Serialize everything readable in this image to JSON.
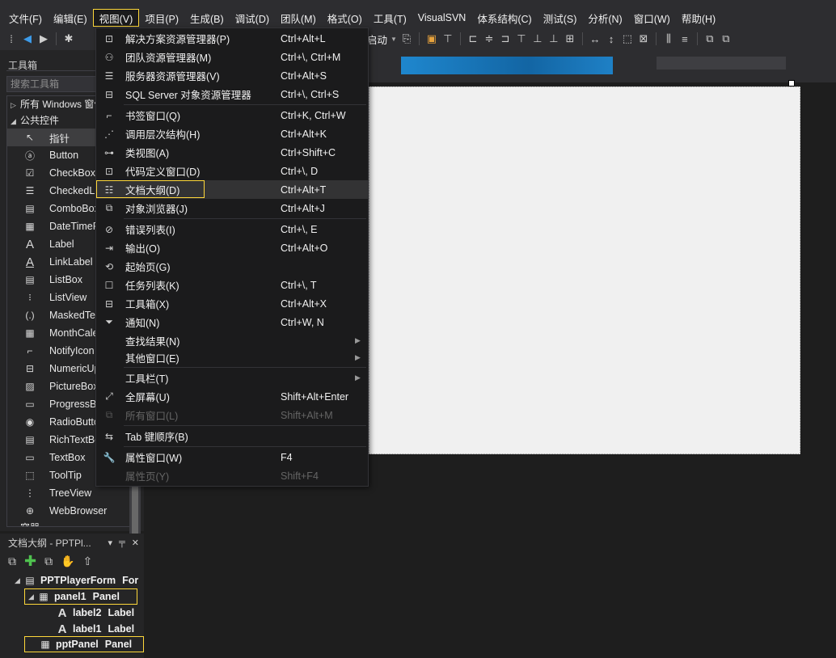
{
  "menubar": {
    "items": [
      "文件(F)",
      "编辑(E)",
      "视图(V)",
      "项目(P)",
      "生成(B)",
      "调试(D)",
      "团队(M)",
      "格式(O)",
      "工具(T)",
      "VisualSVN",
      "体系结构(C)",
      "测试(S)",
      "分析(N)",
      "窗口(W)",
      "帮助(H)"
    ]
  },
  "toolbar": {
    "start_label": "启动"
  },
  "toolbox": {
    "title": "工具箱",
    "search_placeholder": "搜索工具箱",
    "group_all": "所有 Windows 窗体",
    "group_common": "公共控件",
    "items": [
      "指针",
      "Button",
      "CheckBox",
      "CheckedListBox",
      "ComboBox",
      "DateTimePicker",
      "Label",
      "LinkLabel",
      "ListBox",
      "ListView",
      "MaskedTextBox",
      "MonthCalendar",
      "NotifyIcon",
      "NumericUpDown",
      "PictureBox",
      "ProgressBar",
      "RadioButton",
      "RichTextBox",
      "TextBox",
      "ToolTip",
      "TreeView",
      "WebBrowser",
      "容器"
    ],
    "icons": [
      "pointer-icon",
      "button-icon",
      "checkbox-icon",
      "checkedlistbox-icon",
      "combobox-icon",
      "datetimepicker-icon",
      "label-icon",
      "linklabel-icon",
      "listbox-icon",
      "listview-icon",
      "maskedtextbox-icon",
      "monthcalendar-icon",
      "notifyicon-icon",
      "numericupdown-icon",
      "picturebox-icon",
      "progressbar-icon",
      "radiobutton-icon",
      "richtextbox-icon",
      "textbox-icon",
      "tooltip-icon",
      "treeview-icon",
      "webbrowser-icon",
      "container-icon"
    ]
  },
  "outline": {
    "title": "文档大纲 - PPTPl...",
    "nodes": [
      {
        "name": "PPTPlayerForm",
        "type": "For"
      },
      {
        "name": "panel1",
        "type": "Panel"
      },
      {
        "name": "label2",
        "type": "Label"
      },
      {
        "name": "label1",
        "type": "Label"
      },
      {
        "name": "pptPanel",
        "type": "Panel"
      }
    ]
  },
  "view_menu": {
    "items": [
      {
        "label": "解决方案资源管理器(P)",
        "shortcut": "Ctrl+Alt+L",
        "icon": "solution-explorer-icon"
      },
      {
        "label": "团队资源管理器(M)",
        "shortcut": "Ctrl+\\, Ctrl+M",
        "icon": "team-explorer-icon"
      },
      {
        "label": "服务器资源管理器(V)",
        "shortcut": "Ctrl+Alt+S",
        "icon": "server-explorer-icon"
      },
      {
        "label": "SQL Server 对象资源管理器",
        "shortcut": "Ctrl+\\, Ctrl+S",
        "icon": "sql-server-icon"
      },
      {
        "label": "书签窗口(Q)",
        "shortcut": "Ctrl+K, Ctrl+W",
        "icon": "bookmark-icon"
      },
      {
        "label": "调用层次结构(H)",
        "shortcut": "Ctrl+Alt+K",
        "icon": "call-hierarchy-icon"
      },
      {
        "label": "类视图(A)",
        "shortcut": "Ctrl+Shift+C",
        "icon": "class-view-icon"
      },
      {
        "label": "代码定义窗口(D)",
        "shortcut": "Ctrl+\\, D",
        "icon": "code-definition-icon"
      },
      {
        "label": "文档大纲(D)",
        "shortcut": "Ctrl+Alt+T",
        "icon": "document-outline-icon"
      },
      {
        "label": "对象浏览器(J)",
        "shortcut": "Ctrl+Alt+J",
        "icon": "object-browser-icon"
      },
      {
        "label": "错误列表(I)",
        "shortcut": "Ctrl+\\, E",
        "icon": "error-list-icon"
      },
      {
        "label": "输出(O)",
        "shortcut": "Ctrl+Alt+O",
        "icon": "output-icon"
      },
      {
        "label": "起始页(G)",
        "shortcut": "",
        "icon": "start-page-icon"
      },
      {
        "label": "任务列表(K)",
        "shortcut": "Ctrl+\\, T",
        "icon": "task-list-icon"
      },
      {
        "label": "工具箱(X)",
        "shortcut": "Ctrl+Alt+X",
        "icon": "toolbox-icon"
      },
      {
        "label": "通知(N)",
        "shortcut": "Ctrl+W, N",
        "icon": "notification-icon"
      },
      {
        "label": "查找结果(N)",
        "shortcut": "",
        "icon": ""
      },
      {
        "label": "其他窗口(E)",
        "shortcut": "",
        "icon": ""
      },
      {
        "label": "工具栏(T)",
        "shortcut": "",
        "icon": ""
      },
      {
        "label": "全屏幕(U)",
        "shortcut": "Shift+Alt+Enter",
        "icon": "fullscreen-icon"
      },
      {
        "label": "所有窗口(L)",
        "shortcut": "Shift+Alt+M",
        "icon": "all-windows-icon"
      },
      {
        "label": "Tab 键顺序(B)",
        "shortcut": "",
        "icon": "tab-order-icon"
      },
      {
        "label": "属性窗口(W)",
        "shortcut": "F4",
        "icon": "properties-icon"
      },
      {
        "label": "属性页(Y)",
        "shortcut": "Shift+F4",
        "icon": ""
      }
    ]
  },
  "colors": {
    "highlight": "#ffd83a",
    "menu_bg": "#1b1b1c",
    "chrome_bg": "#2d2d30",
    "form_bg": "#f0f0f0",
    "start_green": "#3ec94f"
  }
}
